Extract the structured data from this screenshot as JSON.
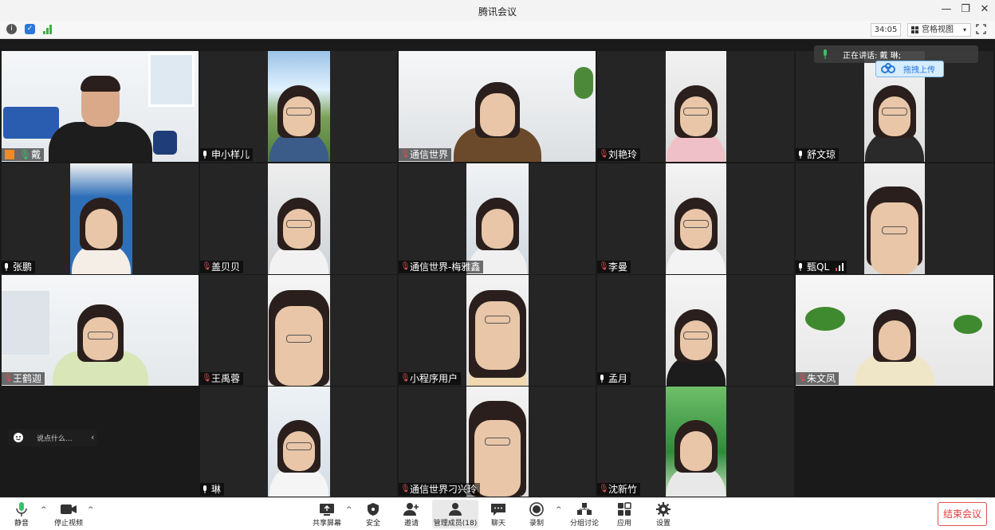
{
  "app": {
    "title": "腾讯会议"
  },
  "infobar": {
    "timer": "34:05",
    "view_label": "宫格视图"
  },
  "speaking": {
    "text": "正在讲话: 戴 琳;"
  },
  "upload": {
    "label": "拖拽上传"
  },
  "say": {
    "placeholder": "说点什么..."
  },
  "colors": {
    "active_border": "#3cc06a",
    "accent": "#2b79d6",
    "end": "#e03a3a"
  },
  "participants": [
    {
      "name": "戴",
      "mic": "on",
      "host": true,
      "active": true
    },
    {
      "name": "申小样儿",
      "mic": "on"
    },
    {
      "name": "通信世界",
      "mic": "muted"
    },
    {
      "name": "刘艳玲",
      "mic": "muted"
    },
    {
      "name": "舒文琼",
      "mic": "on"
    },
    {
      "name": "张鹏",
      "mic": "on"
    },
    {
      "name": "盖贝贝",
      "mic": "muted"
    },
    {
      "name": "通信世界-梅雅鑫",
      "mic": "muted"
    },
    {
      "name": "李曼",
      "mic": "muted"
    },
    {
      "name": "甄QL",
      "mic": "on",
      "signal": true
    },
    {
      "name": "王鹤迦",
      "mic": "muted"
    },
    {
      "name": "王禹蓉",
      "mic": "muted"
    },
    {
      "name": "小程序用户",
      "mic": "muted"
    },
    {
      "name": "孟月",
      "mic": "on"
    },
    {
      "name": "朱文凤",
      "mic": "muted"
    },
    {
      "name": "琳",
      "mic": "on"
    },
    {
      "name": "通信世界刁兴玲",
      "mic": "muted"
    },
    {
      "name": "沈新竹",
      "mic": "muted"
    }
  ],
  "toolbar": {
    "mute": "静音",
    "stop_video": "停止视频",
    "share_screen": "共享屏幕",
    "security": "安全",
    "invite": "邀请",
    "manage_members": "管理成员(18)",
    "chat": "聊天",
    "record": "录制",
    "breakout": "分组讨论",
    "apps": "应用",
    "settings": "设置",
    "end_meeting": "结束会议"
  }
}
